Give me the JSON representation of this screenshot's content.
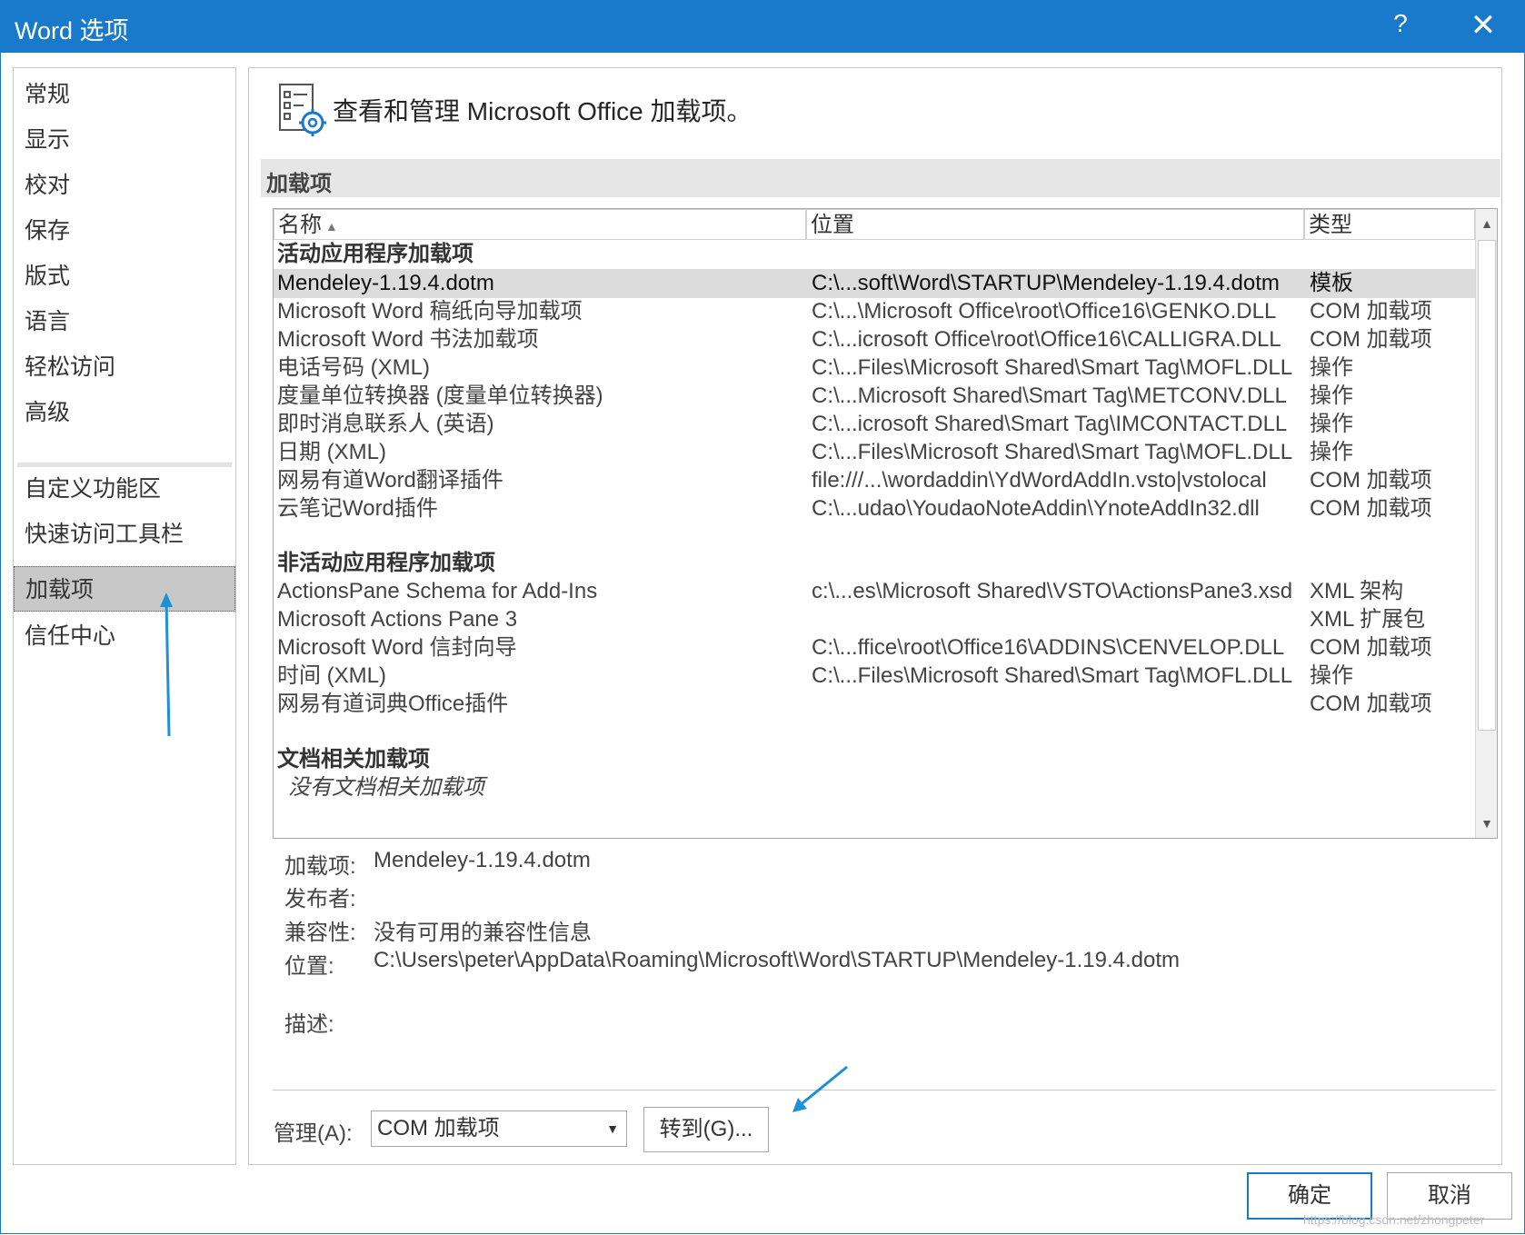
{
  "window": {
    "title": "Word 选项",
    "help": "?",
    "close": "✕"
  },
  "sidebar": {
    "items": [
      {
        "label": "常规"
      },
      {
        "label": "显示"
      },
      {
        "label": "校对"
      },
      {
        "label": "保存"
      },
      {
        "label": "版式"
      },
      {
        "label": "语言"
      },
      {
        "label": "轻松访问"
      },
      {
        "label": "高级"
      },
      {
        "label": "自定义功能区"
      },
      {
        "label": "快速访问工具栏"
      },
      {
        "label": "加载项",
        "selected": true
      },
      {
        "label": "信任中心"
      }
    ]
  },
  "main": {
    "header": "查看和管理 Microsoft Office 加载项。",
    "section_title": "加载项",
    "columns": {
      "name": "名称",
      "location": "位置",
      "type": "类型"
    },
    "groups": {
      "active": "活动应用程序加载项",
      "inactive": "非活动应用程序加载项",
      "document": "文档相关加载项",
      "document_none": "没有文档相关加载项"
    },
    "active_rows": [
      {
        "name": "Mendeley-1.19.4.dotm",
        "location": "C:\\...soft\\Word\\STARTUP\\Mendeley-1.19.4.dotm",
        "type": "模板"
      },
      {
        "name": "Microsoft Word 稿纸向导加载项",
        "location": "C:\\...\\Microsoft Office\\root\\Office16\\GENKO.DLL",
        "type": "COM 加载项"
      },
      {
        "name": "Microsoft Word 书法加载项",
        "location": "C:\\...icrosoft Office\\root\\Office16\\CALLIGRA.DLL",
        "type": "COM 加载项"
      },
      {
        "name": "电话号码 (XML)",
        "location": "C:\\...Files\\Microsoft Shared\\Smart Tag\\MOFL.DLL",
        "type": "操作"
      },
      {
        "name": "度量单位转换器 (度量单位转换器)",
        "location": "C:\\...Microsoft Shared\\Smart Tag\\METCONV.DLL",
        "type": "操作"
      },
      {
        "name": "即时消息联系人 (英语)",
        "location": "C:\\...icrosoft Shared\\Smart Tag\\IMCONTACT.DLL",
        "type": "操作"
      },
      {
        "name": "日期 (XML)",
        "location": "C:\\...Files\\Microsoft Shared\\Smart Tag\\MOFL.DLL",
        "type": "操作"
      },
      {
        "name": "网易有道Word翻译插件",
        "location": "file:///...\\wordaddin\\YdWordAddIn.vsto|vstolocal",
        "type": "COM 加载项"
      },
      {
        "name": "云笔记Word插件",
        "location": "C:\\...udao\\YoudaoNoteAddin\\YnoteAddIn32.dll",
        "type": "COM 加载项"
      }
    ],
    "inactive_rows": [
      {
        "name": "ActionsPane Schema for Add-Ins",
        "location": "c:\\...es\\Microsoft Shared\\VSTO\\ActionsPane3.xsd",
        "type": "XML 架构"
      },
      {
        "name": "Microsoft Actions Pane 3",
        "location": "",
        "type": "XML 扩展包"
      },
      {
        "name": "Microsoft Word 信封向导",
        "location": "C:\\...ffice\\root\\Office16\\ADDINS\\CENVELOP.DLL",
        "type": "COM 加载项"
      },
      {
        "name": "时间 (XML)",
        "location": "C:\\...Files\\Microsoft Shared\\Smart Tag\\MOFL.DLL",
        "type": "操作"
      },
      {
        "name": "网易有道词典Office插件",
        "location": "",
        "type": "COM 加载项"
      }
    ],
    "details": {
      "addin_label": "加载项:",
      "addin_value": "Mendeley-1.19.4.dotm",
      "publisher_label": "发布者:",
      "publisher_value": "",
      "compat_label": "兼容性:",
      "compat_value": "没有可用的兼容性信息",
      "location_label": "位置:",
      "location_value": "C:\\Users\\peter\\AppData\\Roaming\\Microsoft\\Word\\STARTUP\\Mendeley-1.19.4.dotm",
      "desc_label": "描述:"
    },
    "manage": {
      "label": "管理(A):",
      "selected": "COM 加载项",
      "goto": "转到(G)..."
    }
  },
  "footer": {
    "ok": "确定",
    "cancel": "取消"
  },
  "watermark": "https://blog.csdn.net/zhongpeter",
  "colors": {
    "accent": "#1979ca",
    "annotation": "#1e90d6",
    "selection": "#dcdcdc"
  }
}
